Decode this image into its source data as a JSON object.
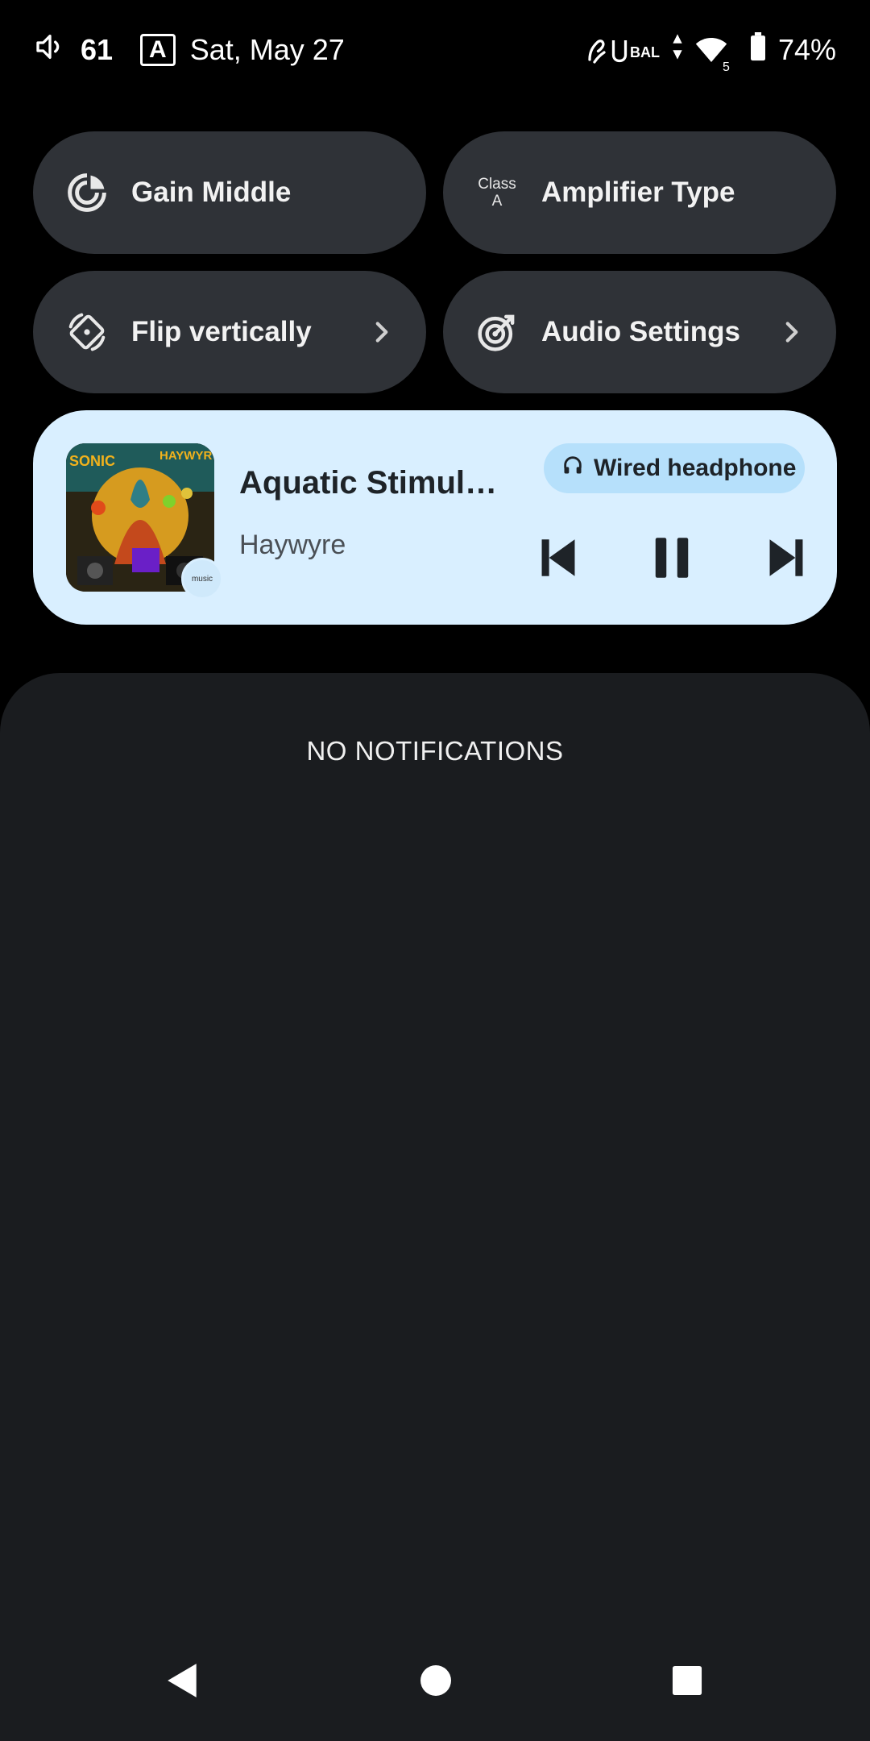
{
  "status_bar": {
    "volume_level": "61",
    "mode_badge": "A",
    "date": "Sat, May 27",
    "bal_label": "BAL",
    "signal_sub": "5",
    "battery_percent": "74%"
  },
  "quick_tiles": [
    {
      "label": "Gain Middle",
      "icon": "gain-icon"
    },
    {
      "label": "Amplifier Type",
      "icon": "class-a-icon",
      "icon_text_top": "Class",
      "icon_text_bottom": "A"
    },
    {
      "label": "Flip vertically",
      "icon": "rotate-icon",
      "chevron": true
    },
    {
      "label": "Audio Settings",
      "icon": "audio-target-icon",
      "chevron": true
    }
  ],
  "media": {
    "title": "Aquatic Stimul…",
    "artist": "Haywyre",
    "output_device": "Wired headphone",
    "app_badge": "music",
    "album_art_text": [
      "SONIC",
      "HAYWYR"
    ]
  },
  "notifications": {
    "empty_label": "NO NOTIFICATIONS"
  },
  "colors": {
    "background": "#000000",
    "tile": "#2f3237",
    "media_card": "#d9efff",
    "output_chip": "#b6e0fb",
    "panel": "#1a1c1f"
  }
}
